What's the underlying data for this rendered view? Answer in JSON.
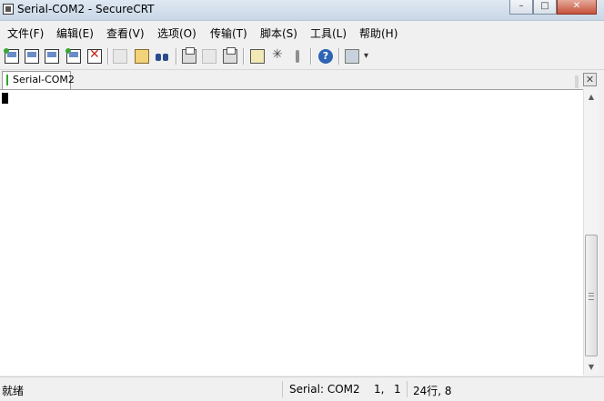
{
  "window": {
    "title": "Serial-COM2 - SecureCRT",
    "controls": {
      "minimize": "–",
      "maximize": "□",
      "close": "✕"
    }
  },
  "menu": [
    "文件(F)",
    "编辑(E)",
    "查看(V)",
    "选项(O)",
    "传输(T)",
    "脚本(S)",
    "工具(L)",
    "帮助(H)"
  ],
  "toolbar": {
    "icons": [
      "connect-icon",
      "quick-connect-icon",
      "connect-in-tab-icon",
      "reconnect-icon",
      "disconnect-icon",
      "copy-icon",
      "paste-icon",
      "find-icon",
      "print-icon",
      "print-setup-icon",
      "print-screen-icon",
      "session-options-icon",
      "global-options-icon",
      "keymap-icon",
      "help-icon",
      "monitor-icon",
      "more-icon"
    ],
    "help_glyph": "?"
  },
  "tabs": [
    {
      "label": "Serial-COM2",
      "status_color": "#31a52f"
    }
  ],
  "tab_close_glyph": "✕",
  "scrollbar": {
    "up": "▲",
    "down": "▼"
  },
  "status": {
    "ready": "就绪",
    "connection": "Serial: COM2",
    "row": "1,",
    "col": "1",
    "size": "24行, 8"
  }
}
